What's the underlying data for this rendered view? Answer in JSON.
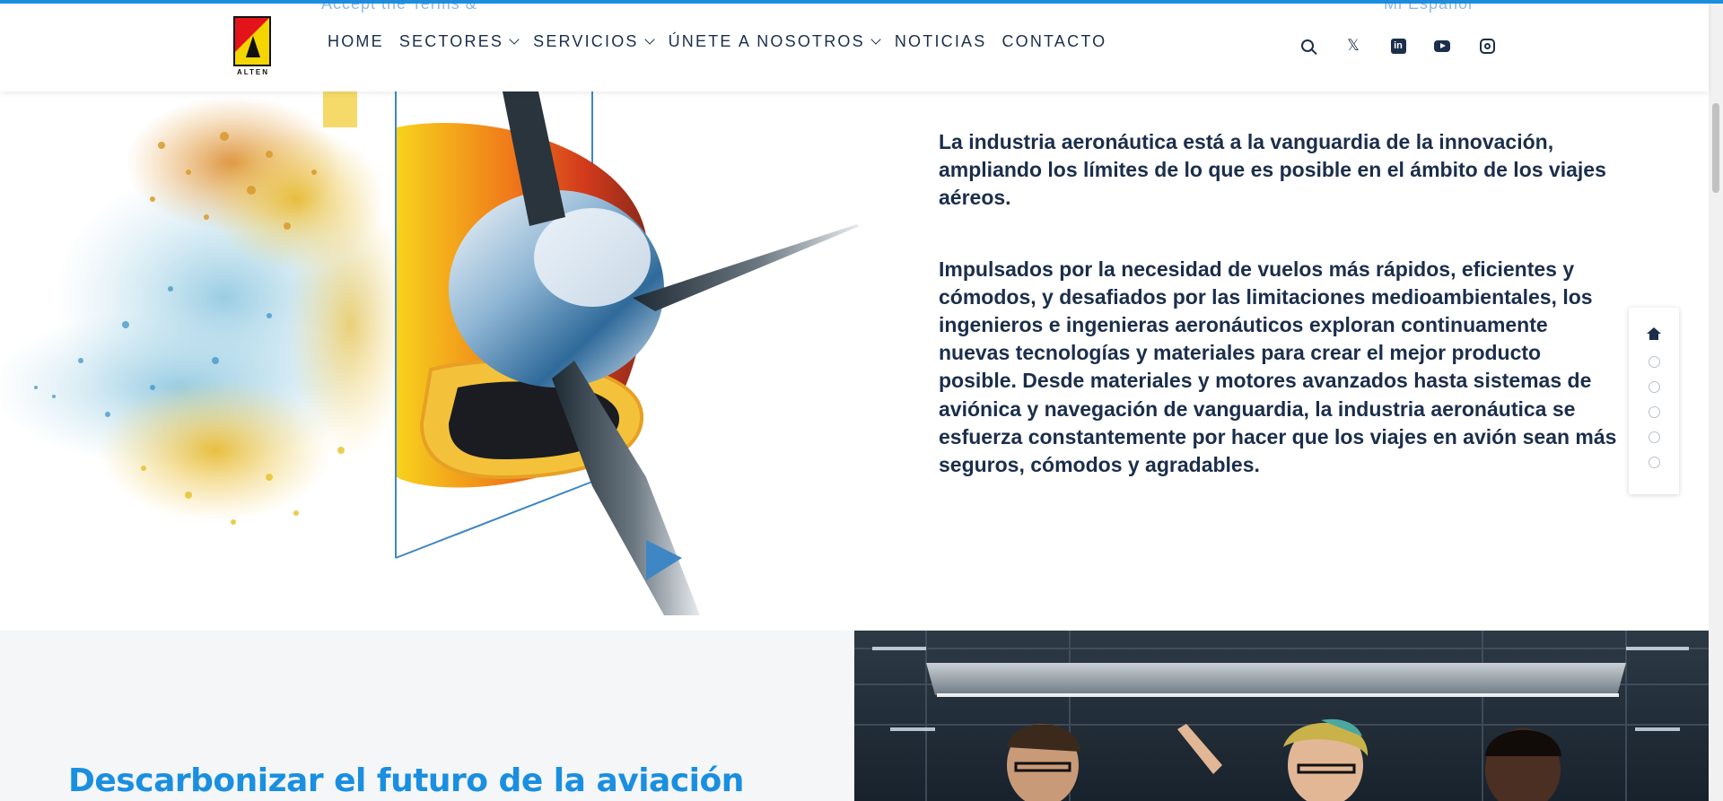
{
  "header": {
    "logo_text": "ALTEN",
    "ghost_left": "Accept the Terms &",
    "ghost_right": "Mi Español",
    "nav": [
      {
        "label": "HOME",
        "dropdown": false
      },
      {
        "label": "SECTORES",
        "dropdown": true
      },
      {
        "label": "SERVICIOS",
        "dropdown": true
      },
      {
        "label": "ÚNETE A NOSOTROS",
        "dropdown": true
      },
      {
        "label": "NOTICIAS",
        "dropdown": false
      },
      {
        "label": "CONTACTO",
        "dropdown": false
      }
    ],
    "social": {
      "search": "search-icon",
      "x": "x-twitter-icon",
      "linkedin": "linkedin-icon",
      "youtube": "youtube-icon",
      "instagram": "instagram-icon",
      "x_glyph": "𝕏",
      "linkedin_glyph": "in"
    }
  },
  "hero": {
    "paragraph_1": "La industria aeronáutica está a la vanguardia de la innovación, ampliando los límites de lo que es posible en el ámbito de los viajes aéreos.",
    "paragraph_2": "Impulsados por la necesidad de vuelos más rápidos, eficientes y cómodos, y desafiados por las limitaciones medioambientales, los ingenieros e ingenieras aeronáuticos exploran continuamente nuevas tecnologías y materiales para crear el mejor producto posible. Desde materiales y motores avanzados hasta sistemas de aviónica y navegación de vanguardia, la industria aeronáutica se esfuerza constantemente por hacer que los viajes en avión sean más seguros, cómodos y agradables."
  },
  "side_nav": {
    "home": "home-icon",
    "dot_count": 5,
    "active_index": 0
  },
  "lower": {
    "title": "Descarbonizar el futuro de la aviación"
  },
  "colors": {
    "brand_blue": "#1a8fe0",
    "text_navy": "#1b2e4b",
    "logo_yellow": "#f4d500",
    "logo_red": "#e3131b"
  }
}
